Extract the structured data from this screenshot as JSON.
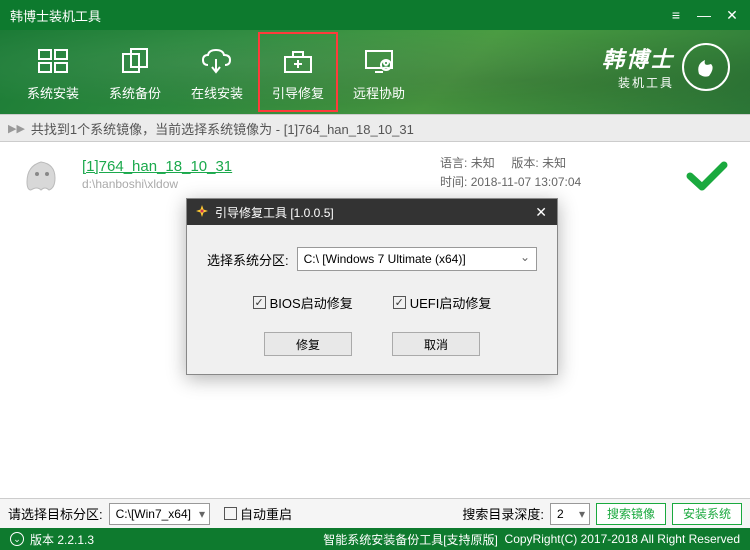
{
  "titlebar": {
    "title": "韩博士装机工具"
  },
  "toolbar": {
    "items": [
      {
        "label": "系统安装"
      },
      {
        "label": "系统备份"
      },
      {
        "label": "在线安装"
      },
      {
        "label": "引导修复"
      },
      {
        "label": "远程协助"
      }
    ],
    "brand_big": "韩博士",
    "brand_small": "装机工具"
  },
  "breadcrumb": "共找到1个系统镜像，当前选择系统镜像为 - [1]764_han_18_10_31",
  "item": {
    "title": "[1]764_han_18_10_31",
    "path": "d:\\hanboshi\\xldow",
    "lang_label": "语言:",
    "lang": "未知",
    "ver_label": "版本:",
    "ver": "未知",
    "time_label": "时间:",
    "time": "2018-11-07 13:07:04"
  },
  "dialog": {
    "title": "引导修复工具 [1.0.0.5]",
    "part_label": "选择系统分区:",
    "part_value": "C:\\ [Windows 7 Ultimate (x64)]",
    "chk_bios": "BIOS启动修复",
    "chk_uefi": "UEFI启动修复",
    "btn_fix": "修复",
    "btn_cancel": "取消"
  },
  "bottom": {
    "target_label": "请选择目标分区:",
    "target_value": "C:\\[Win7_x64]",
    "auto_restart": "自动重启",
    "depth_label": "搜索目录深度:",
    "depth_value": "2",
    "btn_search": "搜索镜像",
    "btn_install": "安装系统"
  },
  "status": {
    "version": "版本 2.2.1.3",
    "desc": "智能系统安装备份工具[支持原版]",
    "copy": "CopyRight(C) 2017-2018 All Right Reserved"
  }
}
